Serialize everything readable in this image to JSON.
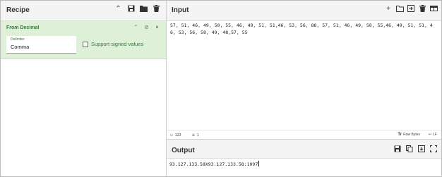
{
  "recipe": {
    "title": "Recipe",
    "operation": {
      "name": "From Decimal",
      "delimiter_label": "Delimiter",
      "delimiter_value": "Comma",
      "signed_label": "Support signed values",
      "signed_checked": false
    }
  },
  "input": {
    "title": "Input",
    "text": "57, 51, 46, 49, 50, 55, 46, 49, 51, 51,46, 53, 56, 88, 57, 51, 46, 49, 50, 55,46, 49, 51, 51, 46, 53, 56, 58, 49, 48,57, 55"
  },
  "status": {
    "length": "123",
    "lines": "1",
    "raw_bytes_label": "Raw Bytes",
    "eol_label": "LF"
  },
  "output": {
    "title": "Output",
    "text": "93.127.133.58X93.127.133.58:1097"
  },
  "icons": {
    "recipe_tools": [
      "chevron-up-icon",
      "save-icon",
      "folder-icon",
      "trash-icon"
    ],
    "op_controls": [
      "chevron-up-icon",
      "disable-icon",
      "pause-icon"
    ],
    "input_tools": [
      "add-icon",
      "folder-icon",
      "import-icon",
      "trash-icon",
      "layout-icon"
    ],
    "output_tools": [
      "save-icon",
      "copy-icon",
      "replace-input-icon",
      "fullscreen-icon"
    ]
  },
  "colors": {
    "operation_bg": "#dff0d8",
    "operation_text": "#3c763d",
    "header_bg": "#f4f4f4"
  }
}
